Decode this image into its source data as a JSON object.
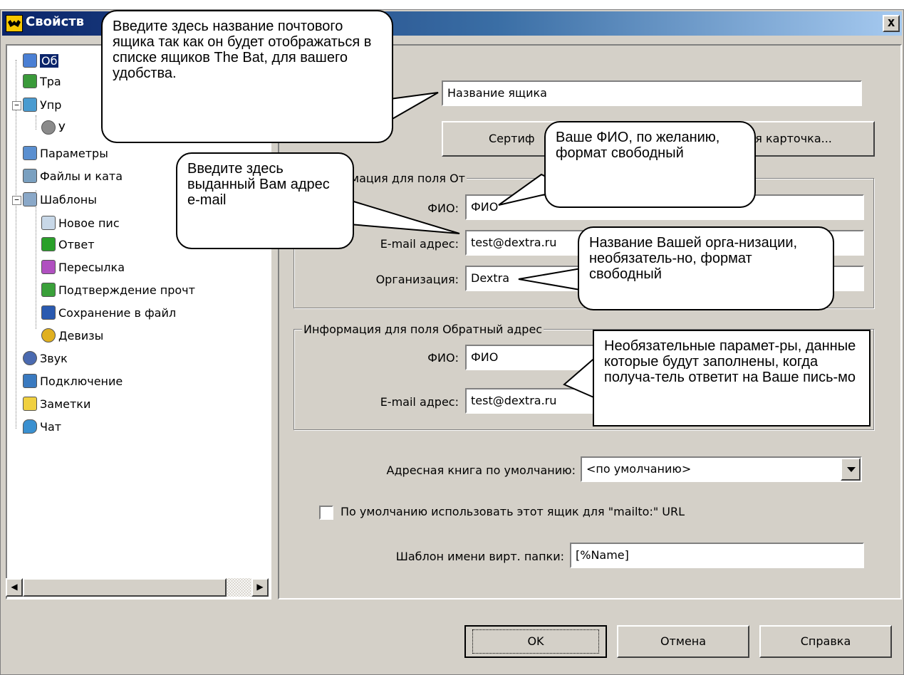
{
  "window": {
    "title": "Свойств",
    "close_label": "x"
  },
  "tree": {
    "items": [
      {
        "label": "Об",
        "icon": "general-icon",
        "color": "#4a7fd4"
      },
      {
        "label": "Тра",
        "icon": "transport-icon",
        "color": "#3a9a3a"
      },
      {
        "label": "Упр",
        "icon": "management-icon",
        "color": "#4a9bd0"
      },
      {
        "label": "У",
        "icon": "disk-icon",
        "color": "#8a8a8a"
      },
      {
        "label": "Параметры",
        "icon": "parameters-icon",
        "color": "#5a8fd0"
      },
      {
        "label": "Файлы и ката",
        "icon": "files-icon",
        "color": "#7aa0c0"
      },
      {
        "label": "Шаблоны",
        "icon": "templates-icon",
        "color": "#8aa8c8"
      },
      {
        "label": "Новое пис",
        "icon": "new-letter-icon",
        "color": "#c8d8e8"
      },
      {
        "label": "Ответ",
        "icon": "reply-icon",
        "color": "#2aa02a"
      },
      {
        "label": "Пересылка",
        "icon": "forward-icon",
        "color": "#b050c0"
      },
      {
        "label": "Подтверждение прочт",
        "icon": "read-confirmation-icon",
        "color": "#3aa03a"
      },
      {
        "label": "Сохранение в файл",
        "icon": "save-to-file-icon",
        "color": "#2a5ab0"
      },
      {
        "label": "Девизы",
        "icon": "mottos-icon",
        "color": "#e0b020"
      },
      {
        "label": "Звук",
        "icon": "sound-icon",
        "color": "#4a6ab0"
      },
      {
        "label": "Подключение",
        "icon": "connection-icon",
        "color": "#3a7ac0"
      },
      {
        "label": "Заметки",
        "icon": "notes-icon",
        "color": "#f0d040"
      },
      {
        "label": "Чат",
        "icon": "chat-icon",
        "color": "#3a90d0"
      }
    ]
  },
  "general": {
    "mailbox_name": "Название ящика",
    "cert_button": "Сертиф",
    "card_button": "ная карточка...",
    "from_group_title": "мация для поля От",
    "from_name_label": "ФИО:",
    "from_name_value": "ФИО",
    "from_email_label": "E-mail адрес:",
    "from_email_value": "test@dextra.ru",
    "org_label": "Организация:",
    "org_value": "Dextra",
    "reply_group_title": "Информация для поля Обратный адрес",
    "reply_name_label": "ФИО:",
    "reply_name_value": "ФИО",
    "reply_email_label": "E-mail адрес:",
    "reply_email_value": "test@dextra.ru",
    "addressbook_label": "Адресная книга по умолчанию:",
    "addressbook_value": "<по умолчанию>",
    "mailto_label": "По умолчанию использовать этот ящик для \"mailto:\" URL",
    "vfolder_label": "Шаблон имени вирт. папки:",
    "vfolder_value": "[%Name]"
  },
  "buttons": {
    "ok": "OK",
    "cancel": "Отмена",
    "help": "Справка"
  },
  "callouts": {
    "mailbox_name": "Введите здесь название почтового ящика так как он будет отображаться в списке ящиков The Bat, для вашего удобства.",
    "email": "Введите здесь выданный Вам адрес e-mail",
    "fio": "Ваше ФИО, по желанию, формат свободный",
    "org": "Название Вашей орга-низации, необязатель-но, формат свободный",
    "reply": "Необязательные парамет-ры, данные которые будут заполнены, когда получа-тель ответит на Ваше пись-мо"
  }
}
